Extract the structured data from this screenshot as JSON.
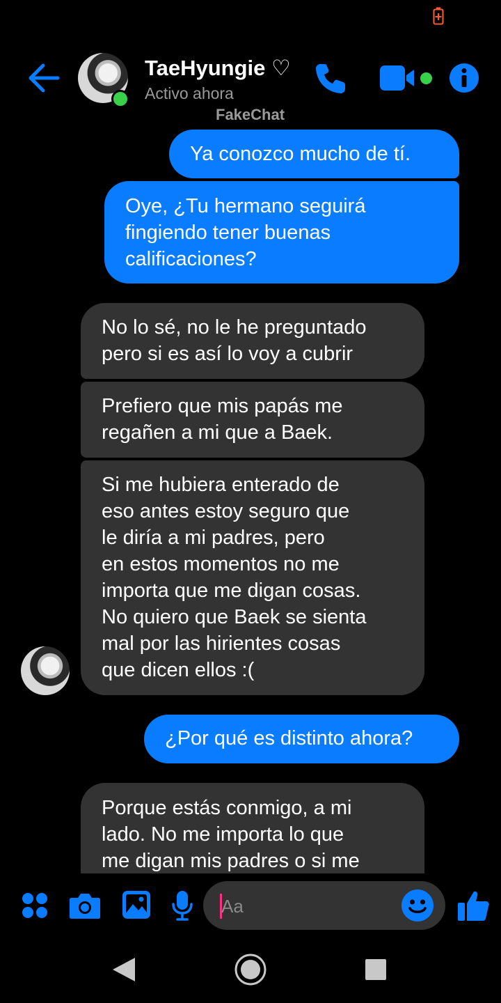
{
  "header": {
    "contact_name": "TaeHyungie",
    "contact_heart": "♡",
    "status": "Activo ahora",
    "watermark": "FakeChat"
  },
  "messages": [
    {
      "direction": "outgoing",
      "text": "Ya conozco mucho de tí."
    },
    {
      "direction": "outgoing",
      "text": "Oye, ¿Tu hermano seguirá\nfingiendo tener buenas\ncalificaciones?"
    },
    {
      "direction": "incoming",
      "text": "No lo sé, no le he preguntado\npero si es así lo voy a cubrir"
    },
    {
      "direction": "incoming",
      "text": "Prefiero que mis papás me\nregañen a mi que a Baek."
    },
    {
      "direction": "incoming",
      "text": "Si me hubiera enterado de\neso antes estoy seguro que\nle diría a mi padres, pero\nen estos momentos no me\nimporta que me digan cosas.\nNo quiero que Baek se sienta\nmal por las hirientes cosas\nque dicen ellos :("
    },
    {
      "direction": "outgoing",
      "text": "¿Por qué es distinto ahora?"
    },
    {
      "direction": "incoming",
      "text": "Porque estás conmigo, a mi\nlado. No me importa lo que\nme digan mis padres o si me"
    }
  ],
  "composer": {
    "placeholder": "Aa"
  },
  "colors": {
    "accent": "#0a7cff",
    "incoming_bubble": "#333333",
    "online": "#3ad14a",
    "caret": "#ff2d85",
    "battery": "#ff5a36"
  },
  "icons": {
    "status_bar": [
      "battery-charging-icon"
    ],
    "header": [
      "back-arrow-icon",
      "phone-icon",
      "video-call-icon",
      "info-icon"
    ],
    "composer": [
      "menu-dots-icon",
      "camera-icon",
      "gallery-icon",
      "microphone-icon",
      "emoji-icon",
      "thumbs-up-icon"
    ],
    "nav": [
      "nav-back-icon",
      "nav-home-icon",
      "nav-recents-icon"
    ]
  }
}
